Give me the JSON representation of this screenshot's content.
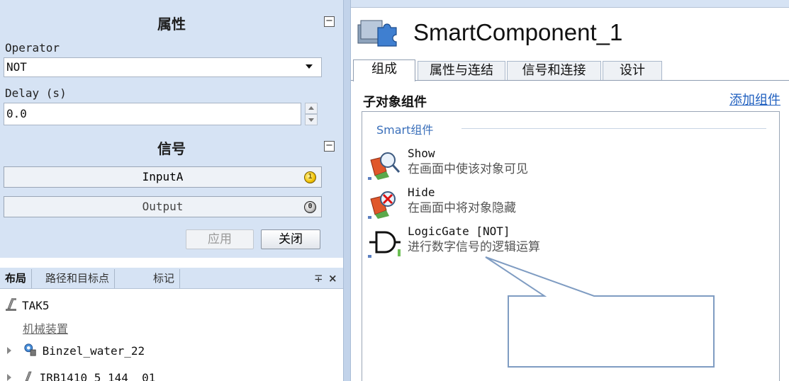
{
  "properties": {
    "title": "属性",
    "collapse_glyph": "−",
    "operator": {
      "label": "Operator",
      "value": "NOT"
    },
    "delay": {
      "label": "Delay (s)",
      "value": "0.0"
    }
  },
  "signals": {
    "title": "信号",
    "collapse_glyph": "−",
    "items": [
      {
        "name": "InputA",
        "state": "1"
      },
      {
        "name": "Output",
        "state": "0"
      }
    ],
    "apply_label": "应用",
    "close_label": "关闭"
  },
  "layout_panel": {
    "tabs": [
      "布局",
      "路径和目标点",
      "标记"
    ],
    "pin_glyph": "∓",
    "close_glyph": "×",
    "tree": [
      {
        "label": "TAK5",
        "icon": "robot-station-icon"
      },
      {
        "label": "机械装置",
        "icon": "none"
      },
      {
        "label": "Binzel_water_22",
        "icon": "tool-icon"
      },
      {
        "label": "IRB1410_5_144__01",
        "icon": "robot-icon"
      }
    ]
  },
  "editor": {
    "title": "SmartComponent_1",
    "tabs": [
      "组成",
      "属性与连结",
      "信号和连接",
      "设计"
    ],
    "active_tab": "组成",
    "section_title": "子对象组件",
    "add_link": "添加组件",
    "group_label": "Smart组件",
    "components": [
      {
        "name": "Show",
        "description": "在画面中使该对象可见",
        "icon": "show-component-icon"
      },
      {
        "name": "Hide",
        "description": "在画面中将对象隐藏",
        "icon": "hide-component-icon"
      },
      {
        "name": "LogicGate [NOT]",
        "description": "进行数字信号的逻辑运算",
        "icon": "logic-gate-icon"
      }
    ]
  },
  "colors": {
    "panel_bg": "#d6e3f4",
    "link": "#1f5fbf",
    "group_label": "#3a6fba",
    "callout_stroke": "#7f9cc2"
  }
}
